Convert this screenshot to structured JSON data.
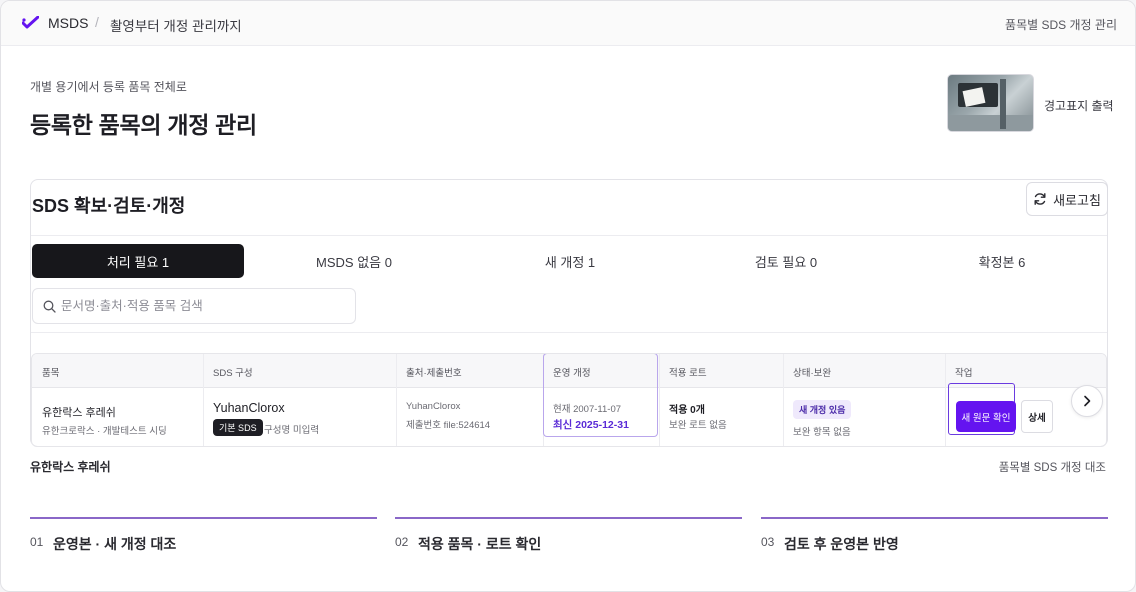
{
  "topbar": {
    "brand": "MSDS",
    "separator": "/",
    "crumb": "촬영부터 개정 관리까지",
    "right_link": "품목별 SDS 개정 관리"
  },
  "header": {
    "eyebrow": "개별 용기에서 등록 품목 전체로",
    "title": "등록한 품목의 개정 관리",
    "print_label": "경고표지 출력"
  },
  "card": {
    "title": "SDS 확보·검토·개정",
    "refresh_label": "새로고침",
    "tabs": [
      {
        "label": "처리 필요 1",
        "active": true
      },
      {
        "label": "MSDS 없음 0",
        "active": false
      },
      {
        "label": "새 개정 1",
        "active": false
      },
      {
        "label": "검토 필요 0",
        "active": false
      },
      {
        "label": "확정본 6",
        "active": false
      }
    ],
    "search_placeholder": "문서명·출처·적용 품목 검색"
  },
  "table": {
    "headers": [
      "품목",
      "SDS 구성",
      "출처·제출번호",
      "운영 개정",
      "적용 로트",
      "상태·보완",
      "작업"
    ],
    "row": {
      "item_name": "유한락스 후레쉬",
      "item_sub": "유한크로락스 · 개발테스트 시딩",
      "sds_name": "YuhanClorox",
      "sds_badge": "기본 SDS",
      "sds_note": "구성명 미입력",
      "source": "YuhanClorox",
      "submission": "제출번호 file:524614",
      "current_rev": "현재 2007-11-07",
      "latest_rev": "최신 2025-12-31",
      "lot": "적용 0개",
      "lot_sub": "보완 로트 없음",
      "status_badge": "새 개정 있음",
      "status_sub": "보완 항목 없음",
      "primary_action": "새 원문 확인",
      "detail_action": "상세"
    }
  },
  "selected": {
    "item": "유한락스 후레쉬",
    "compare_link": "품목별 SDS 개정 대조"
  },
  "steps": [
    {
      "num": "01",
      "label": "운영본 · 새 개정 대조"
    },
    {
      "num": "02",
      "label": "적용 품목 · 로트 확인"
    },
    {
      "num": "03",
      "label": "검토 후 운영본 반영"
    }
  ],
  "colors": {
    "accent": "#6414f0",
    "step_line": "#8a67c8",
    "active_tab": "#17171b"
  }
}
